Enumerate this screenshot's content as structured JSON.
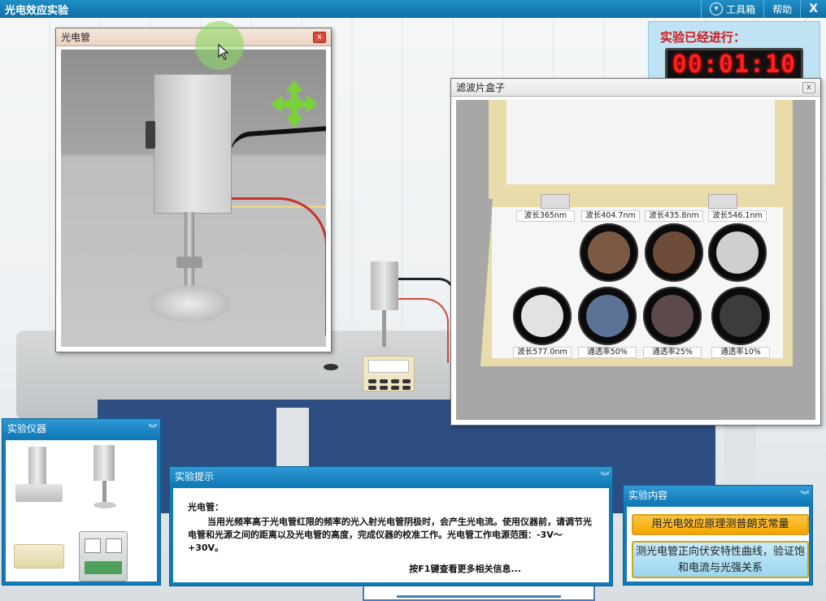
{
  "app": {
    "title": "光电效应实验"
  },
  "topbar": {
    "toolbox_label": "工具箱",
    "help_label": "帮助",
    "close_label": "X"
  },
  "timer": {
    "label": "实验已经进行：",
    "elapsed": "00:01:10"
  },
  "phototube_window": {
    "title": "光电管",
    "close_label": "x"
  },
  "filter_window": {
    "title": "滤波片盒子",
    "close_label": "x",
    "top_row_labels": [
      "波长365nm",
      "波长404.7nm",
      "波长435.8nm",
      "波长546.1nm"
    ],
    "bottom_row_labels": [
      "波长577.0nm",
      "通透率50%",
      "通透率25%",
      "通透率10%"
    ],
    "filter_colors": {
      "w404": "#7a5a45",
      "w435": "#6d4c39",
      "w546": "#cfcfcf",
      "w577": "#e2e2e2",
      "t50": "#5c7397",
      "t25": "#5c4a4a",
      "t10": "#3c3c3c"
    }
  },
  "instruments_panel": {
    "title": "实验仪器"
  },
  "tips_panel": {
    "title": "实验提示",
    "heading": "光电管：",
    "body": "当用光频率高于光电管红限的频率的光入射光电管阴极时，会产生光电流。使用仪器前，请调节光电管和光源之间的距离以及光电管的高度，完成仪器的校准工作。光电管工作电源范围：-3V～+30V。",
    "more": "按F1键查看更多相关信息..."
  },
  "content_panel": {
    "title": "实验内容",
    "items": [
      "用光电效应原理测普朗克常量",
      "测光电管正向伏安特性曲线，验证饱和电流与光强关系"
    ]
  },
  "colors": {
    "accent": "#137ab8",
    "timer_red": "#ff2020",
    "highlight_orange": "#f4a500"
  }
}
